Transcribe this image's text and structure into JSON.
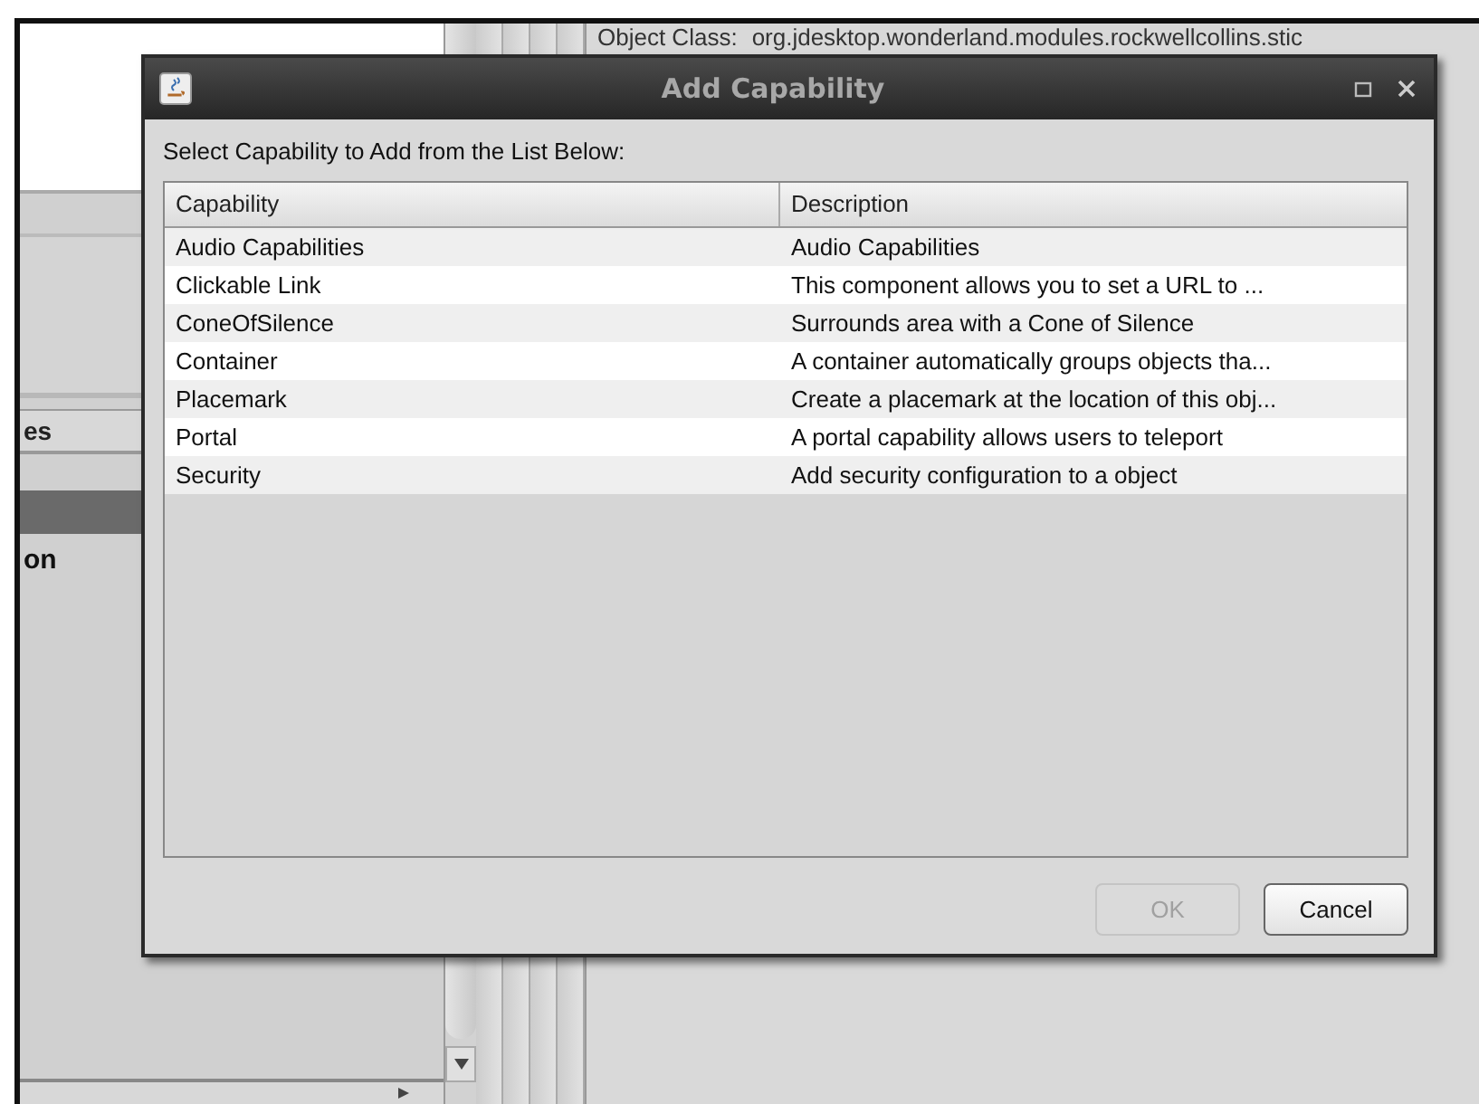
{
  "background": {
    "object_class_label": "Object Class:",
    "object_class_value": "org.jdesktop.wonderland.modules.rockwellcollins.stic",
    "fragments": [
      "es",
      "on"
    ]
  },
  "dialog": {
    "title": "Add Capability",
    "prompt": "Select Capability to Add from the List Below:",
    "columns": [
      "Capability",
      "Description"
    ],
    "rows": [
      {
        "capability": "Audio Capabilities",
        "description": "Audio Capabilities"
      },
      {
        "capability": "Clickable Link",
        "description": "This component allows you to set a URL to ..."
      },
      {
        "capability": "ConeOfSilence",
        "description": "Surrounds area with a Cone of Silence"
      },
      {
        "capability": "Container",
        "description": "A container automatically groups objects tha..."
      },
      {
        "capability": "Placemark",
        "description": "Create a placemark at the location of this obj..."
      },
      {
        "capability": "Portal",
        "description": "A portal capability allows users to teleport"
      },
      {
        "capability": "Security",
        "description": "Add security configuration to a object"
      }
    ],
    "buttons": [
      {
        "label": "OK",
        "disabled": true
      },
      {
        "label": "Cancel",
        "disabled": false
      }
    ]
  }
}
